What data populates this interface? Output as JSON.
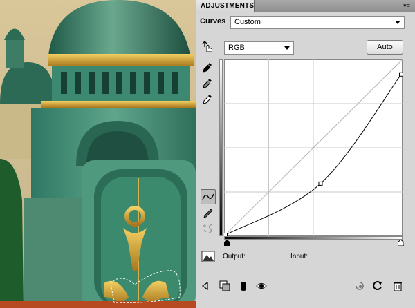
{
  "panel": {
    "tab_title": "ADJUSTMENTS",
    "menu_glyph": "▾≡"
  },
  "curves": {
    "label": "Curves",
    "preset_value": "Custom",
    "channel_value": "RGB",
    "auto_label": "Auto",
    "output_label": "Output:",
    "input_label": "Input:",
    "points": [
      [
        0,
        0
      ],
      [
        138,
        75
      ],
      [
        255,
        235
      ]
    ]
  },
  "colors": {
    "panel_bg": "#d6d6d6",
    "graph_bg": "#ffffff",
    "curve": "#000000",
    "grid": "#c8c8c8"
  },
  "icons": {
    "tools": [
      "on-image-adjust-icon",
      "black-point-eyedropper-icon",
      "gray-point-eyedropper-icon",
      "white-point-eyedropper-icon",
      "curve-edit-points-icon",
      "pencil-draw-icon",
      "smooth-curve-icon"
    ],
    "bottom": [
      "back-arrow-icon",
      "expanded-view-icon",
      "clip-to-layer-icon",
      "visibility-eye-icon",
      "previous-state-icon",
      "reset-icon",
      "trash-icon"
    ]
  }
}
